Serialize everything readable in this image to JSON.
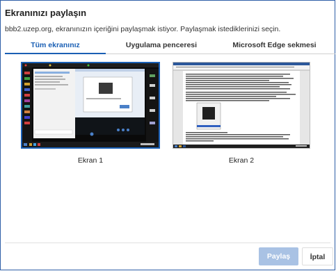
{
  "dialog": {
    "title": "Ekranınızı paylaşın",
    "subtitle": "bbb2.uzep.org, ekranınızın içeriğini paylaşmak istiyor. Paylaşmak istediklerinizi seçin."
  },
  "tabs": [
    {
      "label": "Tüm ekranınız",
      "active": true
    },
    {
      "label": "Uygulama penceresi",
      "active": false
    },
    {
      "label": "Microsoft Edge sekmesi",
      "active": false
    }
  ],
  "screens": [
    {
      "label": "Ekran 1",
      "selected": true
    },
    {
      "label": "Ekran 2",
      "selected": false
    }
  ],
  "buttons": {
    "share": "Paylaş",
    "cancel": "İptal"
  },
  "colors": {
    "accent": "#1a5fb4",
    "share_disabled": "#a9c2e4",
    "dialog_border": "#2f5fa7"
  }
}
